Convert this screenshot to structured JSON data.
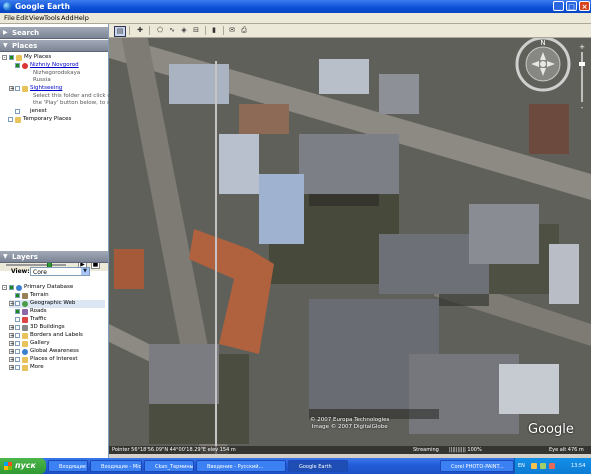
{
  "window": {
    "title": "Google Earth"
  },
  "menu": [
    "File",
    "Edit",
    "View",
    "Tools",
    "Add",
    "Help"
  ],
  "search": {
    "label": "Search"
  },
  "places": {
    "label": "Places",
    "my_places": "My Places",
    "nizhny": "Nizhniy Novgorod",
    "nizhny_desc1": "Nizhegorodskaya",
    "nizhny_desc2": "Russia",
    "sightseeing": "Sightseeing",
    "sightseeing_desc1": "Select this folder and click on",
    "sightseeing_desc2": "the 'Play' button below, to start th",
    "jenest": "jenest",
    "temp": "Temporary Places"
  },
  "layers": {
    "label": "Layers",
    "view_label": "View:",
    "view_value": "Core",
    "items": [
      "Primary Database",
      "Terrain",
      "Geographic Web",
      "Roads",
      "Traffic",
      "3D Buildings",
      "Borders and Labels",
      "Gallery",
      "Global Awareness",
      "Places of Interest",
      "More"
    ]
  },
  "map": {
    "credit_line1": "© 2007 Europa Technologies",
    "credit_line2": "Image © 2007 DigitalGlobe",
    "logo": "Google",
    "status_left": "Pointer  56°18'56.09\"N  44°00'18.29\"E   elev  154 m",
    "status_streaming": "Streaming",
    "status_pct": "|||||||||| 100%",
    "status_eye": "Eye alt  476 m"
  },
  "taskbar": {
    "start": "пуск",
    "tasks": [
      "Входящие - Micro...",
      "Входящие - Micro...",
      "Ckan_Термины",
      "Введение - Русский...",
      "Google Earth",
      "Corel PHOTO-PAINT..."
    ],
    "lang": "EN",
    "clock": "13:54"
  },
  "colors": {
    "title_blue": "#0a4fd6",
    "start_green": "#2f9a2f",
    "taskbar_blue": "#245edb"
  }
}
